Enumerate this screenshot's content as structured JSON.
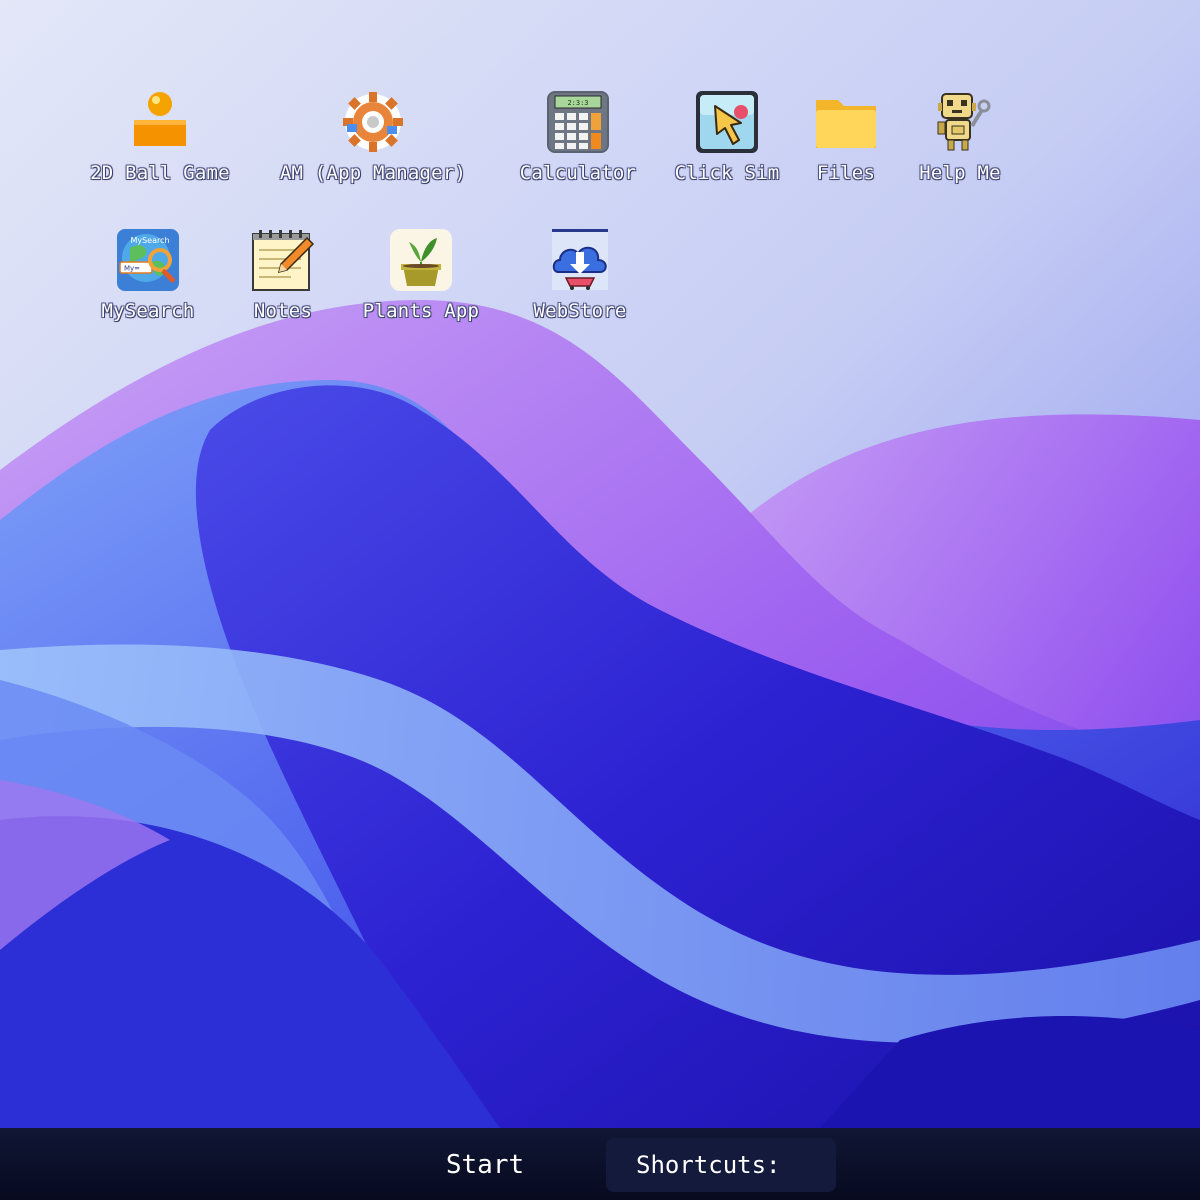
{
  "desktop": {
    "icons": [
      {
        "label": "2D Ball Game",
        "icon": "ball-game-icon"
      },
      {
        "label": "AM (App Manager)",
        "icon": "gear-app-manager-icon"
      },
      {
        "label": "Calculator",
        "icon": "calculator-icon"
      },
      {
        "label": "Click Sim",
        "icon": "click-cursor-icon"
      },
      {
        "label": "Files",
        "icon": "folder-icon"
      },
      {
        "label": "Help Me",
        "icon": "robot-icon"
      },
      {
        "label": "MySearch",
        "icon": "globe-search-icon"
      },
      {
        "label": "Notes",
        "icon": "notepad-icon"
      },
      {
        "label": "Plants App",
        "icon": "plant-pot-icon"
      },
      {
        "label": "WebStore",
        "icon": "cloud-store-icon"
      }
    ],
    "calculator_display": "2:3:3",
    "mysearch_badge": "MySearch",
    "mysearch_field": "My="
  },
  "taskbar": {
    "start_label": "Start",
    "shortcuts_label": "Shortcuts:"
  },
  "colors": {
    "taskbar": "#0a0e26",
    "wallpaper_deep": "#3a2fd6",
    "wallpaper_light": "#dde3f8",
    "wallpaper_violet": "#a85ff0"
  }
}
